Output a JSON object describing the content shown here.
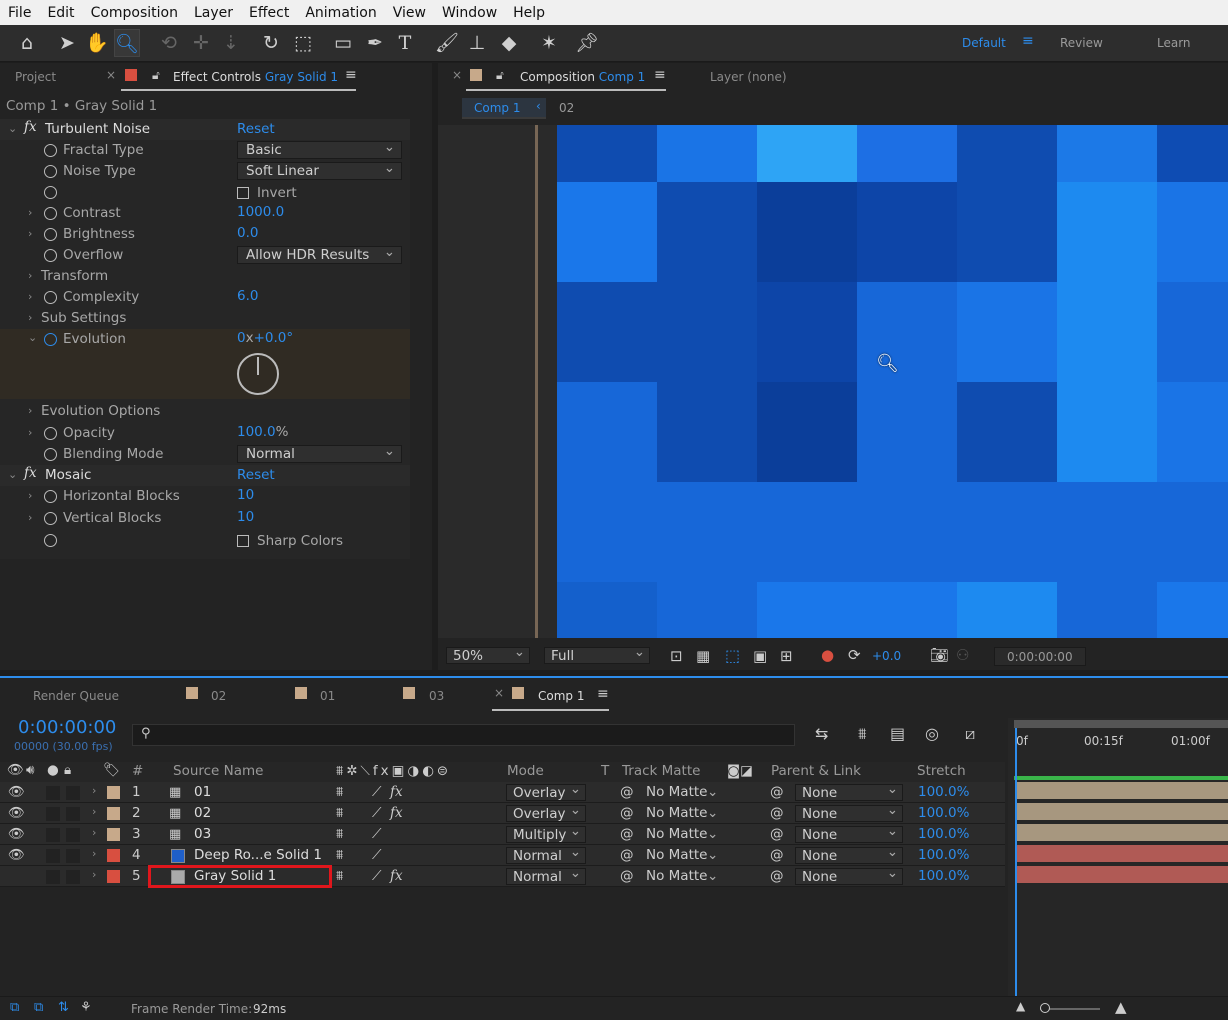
{
  "menu": [
    "File",
    "Edit",
    "Composition",
    "Layer",
    "Effect",
    "Animation",
    "View",
    "Window",
    "Help"
  ],
  "workspaces": {
    "default": "Default",
    "review": "Review",
    "learn": "Learn"
  },
  "left_tabs": {
    "project": "Project",
    "effect_controls": "Effect Controls",
    "layer_name": "Gray Solid 1"
  },
  "ec_breadcrumb": "Comp 1 • Gray Solid 1",
  "effects": [
    {
      "name": "Turbulent Noise",
      "reset": "Reset"
    },
    {
      "name": "Mosaic",
      "reset": "Reset"
    }
  ],
  "props": {
    "fractal_type": {
      "label": "Fractal Type",
      "value": "Basic"
    },
    "noise_type": {
      "label": "Noise Type",
      "value": "Soft Linear"
    },
    "invert": {
      "label": "Invert"
    },
    "contrast": {
      "label": "Contrast",
      "value": "1000.0"
    },
    "brightness": {
      "label": "Brightness",
      "value": "0.0"
    },
    "overflow": {
      "label": "Overflow",
      "value": "Allow HDR Results"
    },
    "transform": {
      "label": "Transform"
    },
    "complexity": {
      "label": "Complexity",
      "value": "6.0"
    },
    "sub_settings": {
      "label": "Sub Settings"
    },
    "evolution": {
      "label": "Evolution",
      "value": "0",
      "x_sep": "x",
      "value2": "+0.0°"
    },
    "evolution_options": {
      "label": "Evolution Options"
    },
    "opacity": {
      "label": "Opacity",
      "value": "100.0",
      "unit": "%"
    },
    "blending_mode": {
      "label": "Blending Mode",
      "value": "Normal"
    },
    "h_blocks": {
      "label": "Horizontal Blocks",
      "value": "10"
    },
    "v_blocks": {
      "label": "Vertical Blocks",
      "value": "10"
    },
    "sharp_colors": {
      "label": "Sharp Colors"
    }
  },
  "comp_tabs": {
    "composition": "Composition",
    "comp_name": "Comp 1",
    "layer": "Layer (none)",
    "crumb1": "Comp 1",
    "crumb2": "02"
  },
  "viewer_bar": {
    "zoom": "50%",
    "resolution": "Full",
    "exposure": "+0.0",
    "time": "0:00:00:00"
  },
  "timeline_tabs": [
    "Render Queue",
    "02",
    "01",
    "03",
    "Comp 1"
  ],
  "timecode": "0:00:00:00",
  "frames": "00000 (30.00 fps)",
  "ruler": [
    "0f",
    "00:15f",
    "01:00f"
  ],
  "columns": {
    "num": "#",
    "source": "Source Name",
    "mode": "Mode",
    "t": "T",
    "track_matte": "Track Matte",
    "parent": "Parent & Link",
    "stretch": "Stretch"
  },
  "layers": [
    {
      "num": "1",
      "name": "01",
      "mode": "Overlay",
      "matte": "No Matte",
      "parent": "None",
      "stretch": "100.0%"
    },
    {
      "num": "2",
      "name": "02",
      "mode": "Overlay",
      "matte": "No Matte",
      "parent": "None",
      "stretch": "100.0%"
    },
    {
      "num": "3",
      "name": "03",
      "mode": "Multiply",
      "matte": "No Matte",
      "parent": "None",
      "stretch": "100.0%"
    },
    {
      "num": "4",
      "name": "Deep Ro...e Solid 1",
      "mode": "Normal",
      "matte": "No Matte",
      "parent": "None",
      "stretch": "100.0%"
    },
    {
      "num": "5",
      "name": "Gray Solid 1",
      "mode": "Normal",
      "matte": "No Matte",
      "parent": "None",
      "stretch": "100.0%"
    }
  ],
  "status": {
    "label": "Frame Render Time:",
    "value": "92ms"
  },
  "colors": {
    "accent": "#2d8ceb",
    "label_tan": "#c7a98a",
    "label_red": "#d84f40",
    "highlight": "#e0161c"
  }
}
